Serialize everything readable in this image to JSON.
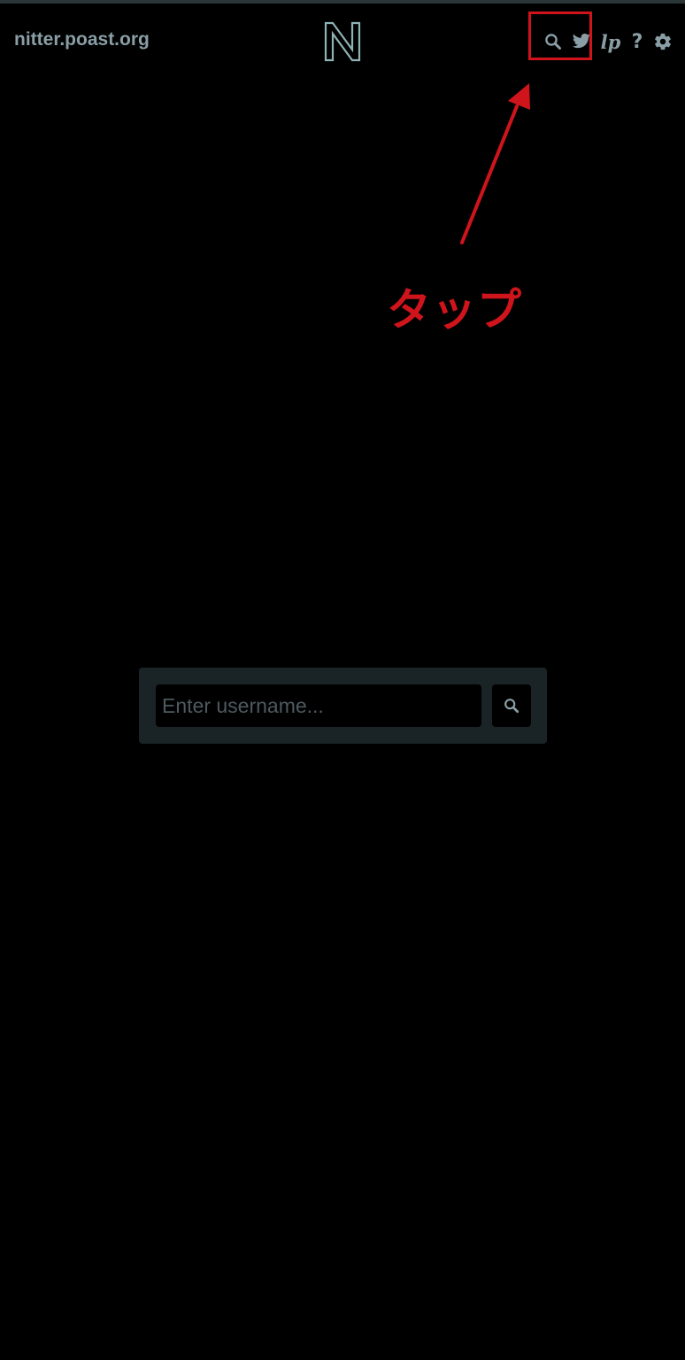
{
  "navbar": {
    "site_name": "nitter.poast.org",
    "logo_letter": "N",
    "icons": {
      "search": "search-icon",
      "twitter": "twitter-bird-icon",
      "lp": "lp",
      "help": "?",
      "settings": "gear-icon"
    },
    "icon_color": "#8a9ea6"
  },
  "annotation": {
    "label": "タップ",
    "color": "#d0141c"
  },
  "search_panel": {
    "placeholder": "Enter username...",
    "value": ""
  },
  "colors": {
    "background": "#000000",
    "panel": "#1a2325",
    "logo_stroke": "#8fb3b5"
  }
}
